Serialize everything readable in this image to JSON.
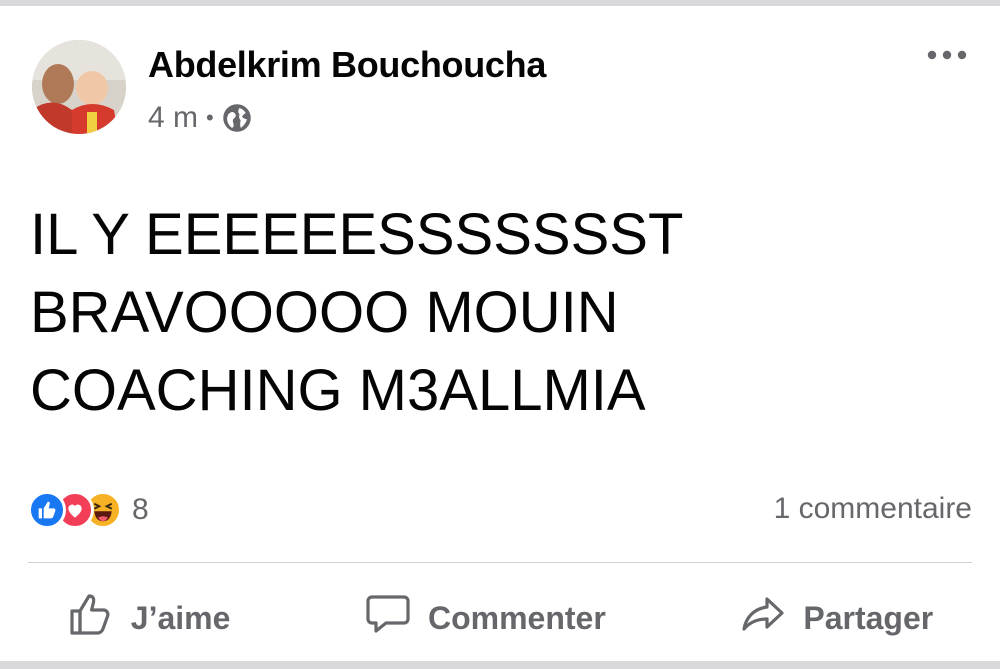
{
  "post": {
    "author": "Abdelkrim Bouchoucha",
    "time": "4 m",
    "separator": "•",
    "privacy_icon": "globe-icon",
    "more_icon": "more-options-icon",
    "text_lines": [
      "IL Y EEEEEESSSSSSST",
      "BRAVOOOOO MOUIN",
      "COACHING M3ALLMIA"
    ]
  },
  "reactions": {
    "icons": [
      "like-reaction-icon",
      "love-reaction-icon",
      "haha-reaction-icon"
    ],
    "count": "8",
    "comments": "1 commentaire"
  },
  "actions": {
    "like": "J’aime",
    "comment": "Commenter",
    "share": "Partager"
  },
  "colors": {
    "like_blue": "#1877f2",
    "love_red": "#f33e58",
    "haha_yellow": "#f7b125",
    "secondary_text": "#65676b",
    "primary_text": "#050505"
  }
}
